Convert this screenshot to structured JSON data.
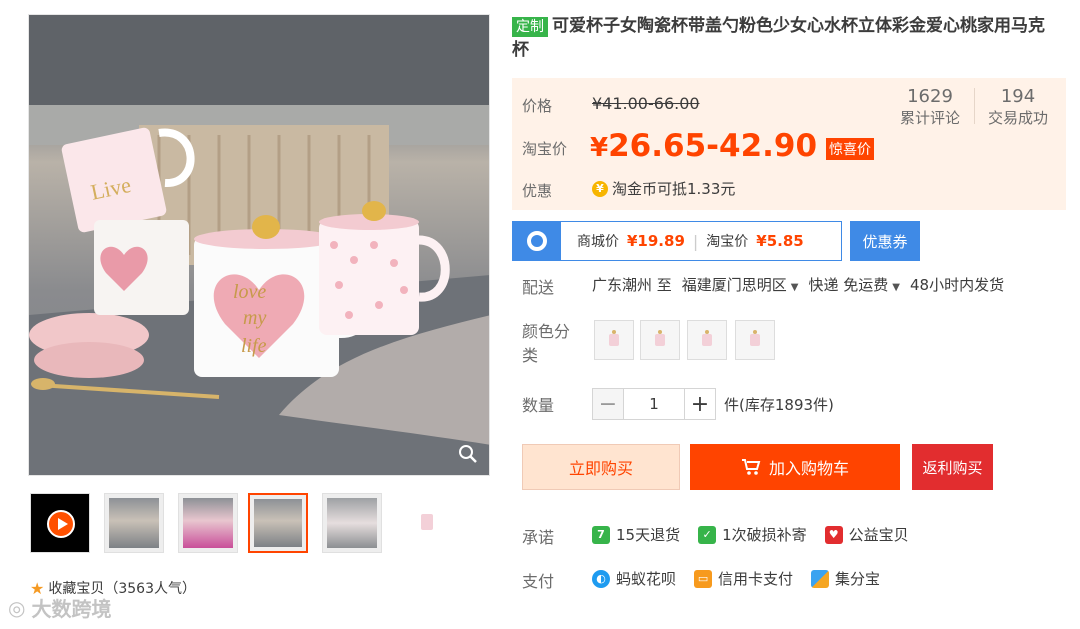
{
  "title": {
    "tag": "定制",
    "text": "可爱杯子女陶瓷杯带盖勺粉色少女心水杯立体彩金爱心桃家用马克杯"
  },
  "price": {
    "label": "价格",
    "original": "¥41.00-66.00",
    "tb_label": "淘宝价",
    "tb_yen": "¥",
    "tb_value": "26.65-42.90",
    "tb_badge": "惊喜价",
    "reviews_count": "1629",
    "reviews_label": "累计评论",
    "sales_count": "194",
    "sales_label": "交易成功",
    "discount_label": "优惠",
    "coin_icon": "¥",
    "coin_text": "淘金币可抵1.33元"
  },
  "mall": {
    "label1": "商城价",
    "price1": "¥19.89",
    "sep": "|",
    "label2": "淘宝价",
    "price2": "¥5.85",
    "coupon": "优惠券"
  },
  "delivery": {
    "label": "配送",
    "from": "广东潮州 至",
    "to": "福建厦门思明区",
    "method": "快递 免运费",
    "time": "48小时内发货"
  },
  "options": {
    "color_label_line1": "颜色分",
    "color_label_line2": "类"
  },
  "quantity": {
    "label": "数量",
    "minus": "−",
    "value": "1",
    "plus": "+",
    "stock": "件(库存1893件)"
  },
  "actions": {
    "buy": "立即购买",
    "cart": "加入购物车",
    "rebate": "返利购买"
  },
  "promise": {
    "label": "承诺",
    "items": [
      "15天退货",
      "1次破损补寄",
      "公益宝贝"
    ]
  },
  "payment": {
    "label": "支付",
    "items": [
      "蚂蚁花呗",
      "信用卡支付",
      "集分宝"
    ]
  },
  "favorite": {
    "text": "收藏宝贝（3563人气）"
  },
  "watermark": {
    "text": "大数跨境"
  },
  "main_image": {
    "mug_text_1": "love",
    "mug_text_2": "my",
    "mug_text_3": "life"
  },
  "colors": {
    "accent": "#ff4400",
    "tb_blue": "#3f8ae6",
    "green_tag": "#37b44a",
    "rebate_red": "#e22d2f"
  }
}
